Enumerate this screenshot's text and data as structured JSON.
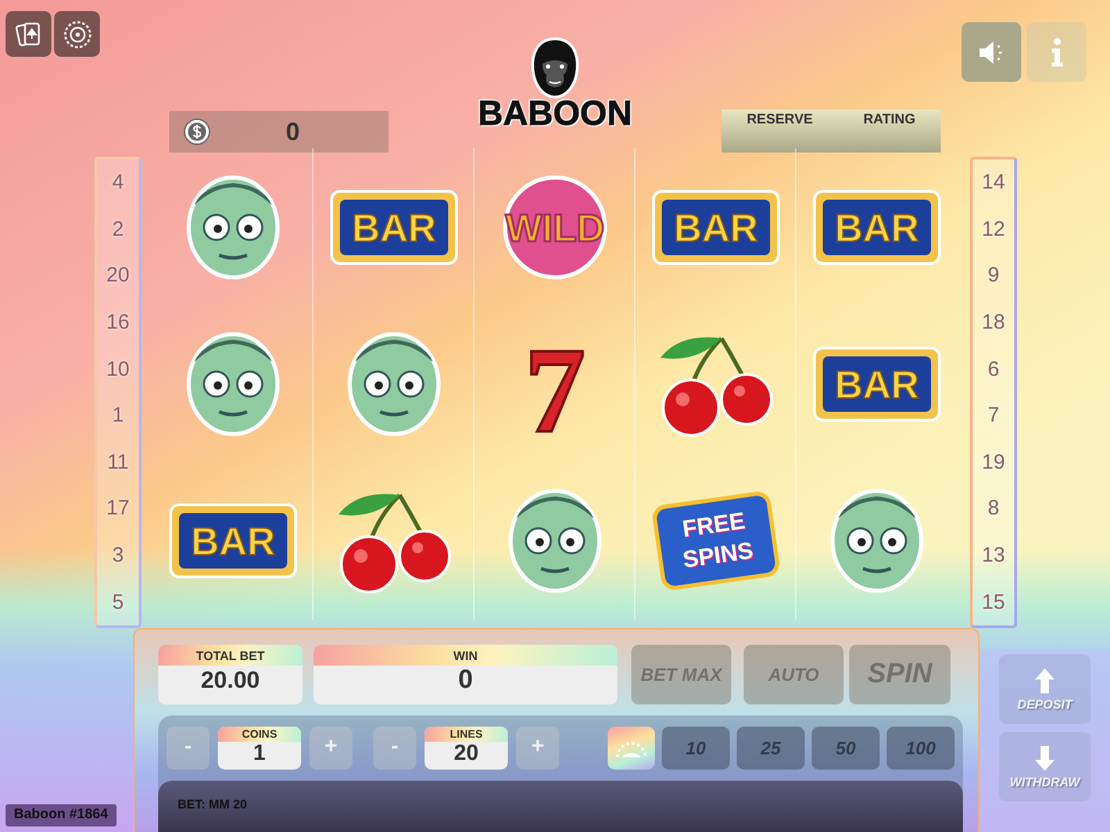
{
  "top_left_buttons": [
    {
      "kind": "cards"
    },
    {
      "kind": "roulette"
    }
  ],
  "balance": {
    "value": "0"
  },
  "logo": {
    "text": "BABOON"
  },
  "stats": {
    "labels": [
      "RESERVE",
      "RATING"
    ]
  },
  "top_right_buttons": [
    {
      "kind": "sound",
      "disabled": false
    },
    {
      "kind": "info",
      "disabled": true
    }
  ],
  "left_lines": [
    "4",
    "2",
    "20",
    "16",
    "10",
    "1",
    "11",
    "17",
    "3",
    "5"
  ],
  "right_lines": [
    "14",
    "12",
    "9",
    "18",
    "6",
    "7",
    "19",
    "8",
    "13",
    "15"
  ],
  "reel_rows": [
    [
      {
        "kind": "zombie"
      },
      {
        "kind": "bar",
        "label": "BAR"
      },
      {
        "kind": "wild",
        "label": "WILD"
      },
      {
        "kind": "bar",
        "label": "BAR"
      },
      {
        "kind": "bar",
        "label": "BAR"
      }
    ],
    [
      {
        "kind": "zombie"
      },
      {
        "kind": "zombie"
      },
      {
        "kind": "seven",
        "label": "7"
      },
      {
        "kind": "cherry"
      },
      {
        "kind": "bar",
        "label": "BAR"
      }
    ],
    [
      {
        "kind": "bar",
        "label": "BAR"
      },
      {
        "kind": "cherry"
      },
      {
        "kind": "zombie"
      },
      {
        "kind": "free_spins",
        "label": "FREE SPINS"
      },
      {
        "kind": "zombie"
      }
    ]
  ],
  "total_bet": {
    "label": "TOTAL BET",
    "value": "20.00"
  },
  "win": {
    "label": "WIN",
    "value": "0"
  },
  "action_buttons": [
    {
      "label": "BET MAX",
      "disabled": true
    },
    {
      "label": "AUTO",
      "disabled": true
    },
    {
      "label": "SPIN",
      "disabled": true
    }
  ],
  "steppers": [
    {
      "label": "COINS",
      "value": "1",
      "minus": "-",
      "plus": "+"
    },
    {
      "label": "LINES",
      "value": "20",
      "minus": "-",
      "plus": "+"
    }
  ],
  "chips": [
    "10",
    "25",
    "50",
    "100"
  ],
  "bet_info": "BET: MM 20",
  "side_buttons": [
    {
      "kind": "deposit",
      "label": "DEPOSIT",
      "disabled": true
    },
    {
      "kind": "withdraw",
      "label": "WITHDRAW",
      "disabled": true
    }
  ],
  "game_id": "Baboon #1864"
}
